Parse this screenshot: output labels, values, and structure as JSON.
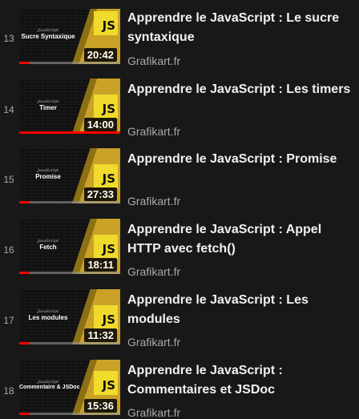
{
  "playlist": {
    "items": [
      {
        "index": "13",
        "title": "Apprendre le JavaScript : Le sucre syntaxique",
        "channel": "Grafikart.fr",
        "thumb_kicker": "JavaScript",
        "thumb_title": "Sucre Syntaxique",
        "thumb_badge": "JS",
        "duration": "20:42",
        "progress_fraction": 0.1
      },
      {
        "index": "14",
        "title": "Apprendre le JavaScript : Les timers",
        "channel": "Grafikart.fr",
        "thumb_kicker": "JavaScript",
        "thumb_title": "Timer",
        "thumb_badge": "JS",
        "duration": "14:00",
        "progress_fraction": 1.0
      },
      {
        "index": "15",
        "title": "Apprendre le JavaScript : Promise",
        "channel": "Grafikart.fr",
        "thumb_kicker": "JavaScript",
        "thumb_title": "Promise",
        "thumb_badge": "JS",
        "duration": "27:33",
        "progress_fraction": 0.1
      },
      {
        "index": "16",
        "title": "Apprendre le JavaScript : Appel HTTP avec fetch()",
        "channel": "Grafikart.fr",
        "thumb_kicker": "JavaScript",
        "thumb_title": "Fetch",
        "thumb_badge": "JS",
        "duration": "18:11",
        "progress_fraction": 0.1
      },
      {
        "index": "17",
        "title": "Apprendre le JavaScript : Les modules",
        "channel": "Grafikart.fr",
        "thumb_kicker": "JavaScript",
        "thumb_title": "Les modules",
        "thumb_badge": "JS",
        "duration": "11:32",
        "progress_fraction": 0.1
      },
      {
        "index": "18",
        "title": "Apprendre le JavaScript : Commentaires et JSDoc",
        "channel": "Grafikart.fr",
        "thumb_kicker": "JavaScript",
        "thumb_title": "Commentaire & JSDoc",
        "thumb_badge": "JS",
        "duration": "15:36",
        "progress_fraction": 0.1
      }
    ]
  },
  "colors": {
    "background": "#181818",
    "progress": "#ff0000",
    "badge": "#f0db2c",
    "accent_gold": "#c9a227",
    "title_text": "#f1f1f1",
    "secondary_text": "#aaaaaa"
  }
}
